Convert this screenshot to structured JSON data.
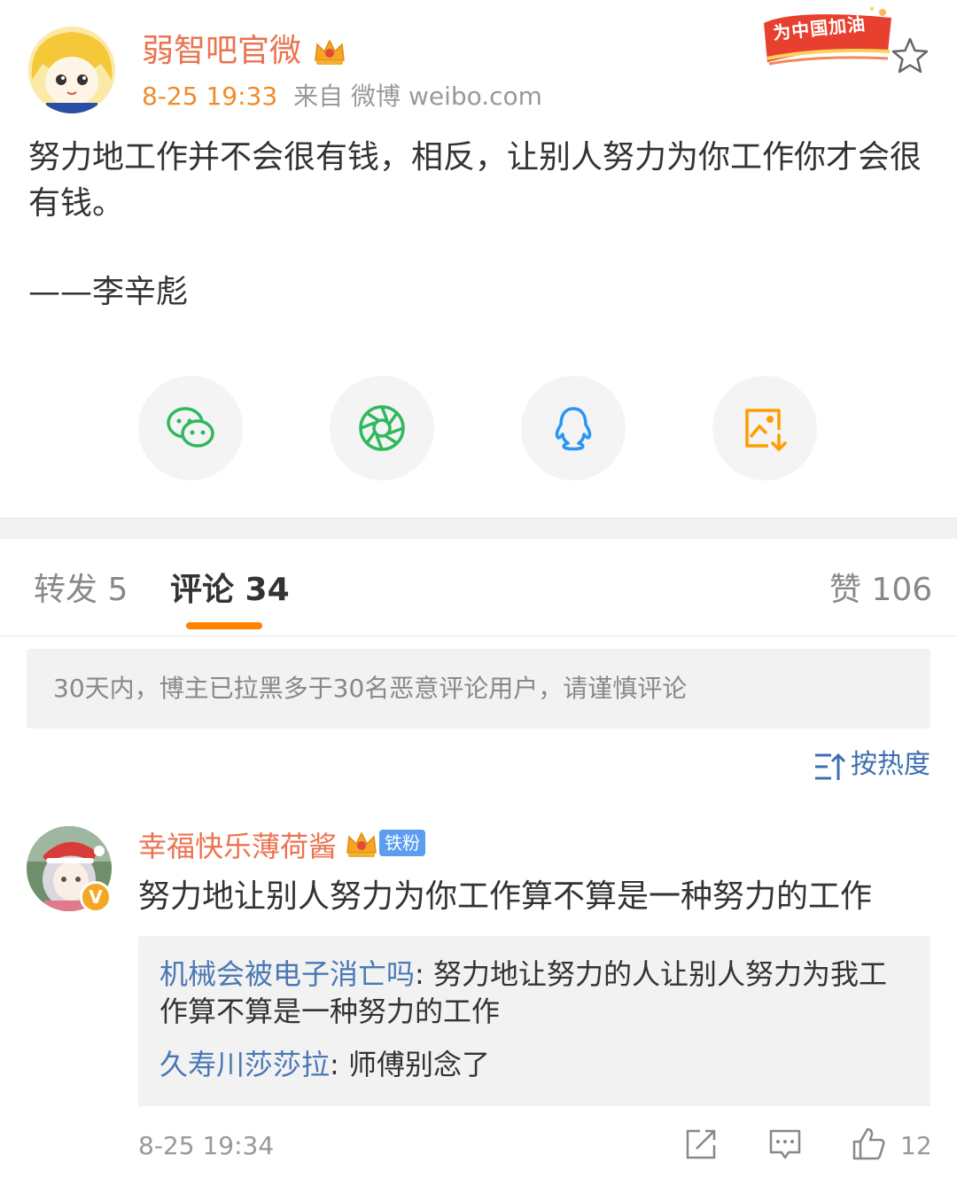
{
  "post": {
    "author": "弱智吧官微",
    "time": "8-25 19:33",
    "source": "来自 微博 weibo.com",
    "campaign_badge": "为中国加油",
    "body": "努力地工作并不会很有钱，相反，让别人努力为你工作你才会很有钱。",
    "signature": "——李辛彪"
  },
  "share": {
    "icons": [
      "wechat-icon",
      "moments-icon",
      "qq-icon",
      "save-image-icon"
    ],
    "colors": {
      "wechat": "#2fb95c",
      "moments": "#2fb95c",
      "qq": "#2a96f3",
      "save": "#ff9d00"
    }
  },
  "tabs": {
    "repost": "转发 5",
    "comments": "评论 34",
    "likes": "赞 106"
  },
  "notice": "30天内，博主已拉黑多于30名恶意评论用户，请谨慎评论",
  "sort": {
    "label": "按热度"
  },
  "comment": {
    "user": "幸福快乐薄荷酱",
    "fan_badge": "铁粉",
    "verified_glyph": "V",
    "text": "努力地让别人努力为你工作算不算是一种努力的工作",
    "replies": [
      {
        "user": "机械会被电子消亡吗",
        "text": ": 努力地让努力的人让别人努力为我工作算不算是一种努力的工作"
      },
      {
        "user": "久寿川莎莎拉",
        "text": ": 师傅别念了"
      }
    ],
    "time": "8-25 19:34",
    "likes": "12"
  },
  "colors": {
    "accent": "#ff8200",
    "name": "#eb7350",
    "link": "#4a78b4",
    "muted": "#999999"
  }
}
